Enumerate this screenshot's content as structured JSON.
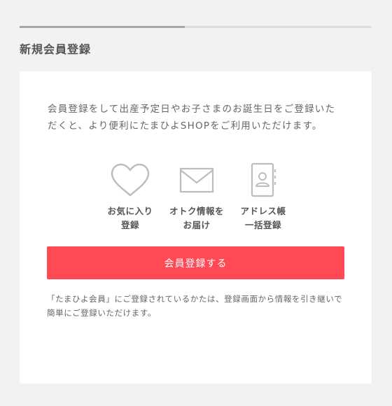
{
  "header": {
    "progress_fraction": 0.47,
    "title": "新規会員登録"
  },
  "intro_text": "会員登録をして出産予定日やお子さまのお誕生日をご登録いただくと、より便利にたまひよSHOPをご利用いただけます。",
  "features": [
    {
      "icon": "heart-icon",
      "line1": "お気に入り",
      "line2": "登録"
    },
    {
      "icon": "envelope-icon",
      "line1": "オトク情報を",
      "line2": "お届け"
    },
    {
      "icon": "address-book-icon",
      "line1": "アドレス帳",
      "line2": "一括登録"
    }
  ],
  "register_button_label": "会員登録する",
  "note_text": "「たまひよ会員」にご登録されているかたは、登録画面から情報を引き継いで簡単にご登録いただけます。",
  "colors": {
    "page_background": "#f2f2f2",
    "card_background": "#ffffff",
    "button": "#ff4a56",
    "button_text": "#ffffff",
    "text": "#555555",
    "icon_stroke": "#bdbdbd"
  }
}
